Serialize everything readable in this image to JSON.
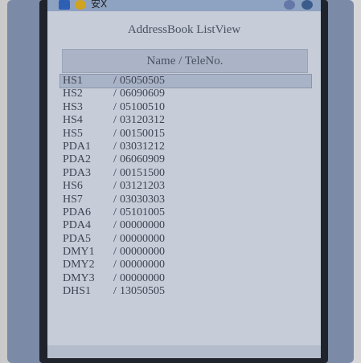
{
  "status_bar": {
    "text": "安X",
    "icons": [
      "start-icon",
      "app-icon",
      "sync-icon",
      "settings-icon"
    ]
  },
  "window": {
    "title": "AddressBook ListView"
  },
  "list": {
    "header": "Name / TeleNo.",
    "separator": "/",
    "selected_index": 0,
    "rows": [
      {
        "name": "HS1",
        "number": "05050505"
      },
      {
        "name": "HS2",
        "number": "06090609"
      },
      {
        "name": "HS3",
        "number": "05100510"
      },
      {
        "name": "HS4",
        "number": "03120312"
      },
      {
        "name": "HS5",
        "number": "00150015"
      },
      {
        "name": "PDA1",
        "number": "03031212"
      },
      {
        "name": "PDA2",
        "number": "06060909"
      },
      {
        "name": "PDA3",
        "number": "00151500"
      },
      {
        "name": "HS6",
        "number": "03121203"
      },
      {
        "name": "HS7",
        "number": "03030303"
      },
      {
        "name": "PDA6",
        "number": "05101005"
      },
      {
        "name": "PDA4",
        "number": "00000000"
      },
      {
        "name": "PDA5",
        "number": "00000000"
      },
      {
        "name": "DMY1",
        "number": "00000000"
      },
      {
        "name": "DMY2",
        "number": "00000000"
      },
      {
        "name": "DMY3",
        "number": "00000000"
      },
      {
        "name": "DHS1",
        "number": "13050505"
      }
    ]
  },
  "colors": {
    "screen_bg": "#c6cdd8",
    "header_bg": "#aab4c6",
    "selection_bg": "#a9b3c7",
    "text": "#3d4452",
    "bezel": "#7b8aa6"
  }
}
